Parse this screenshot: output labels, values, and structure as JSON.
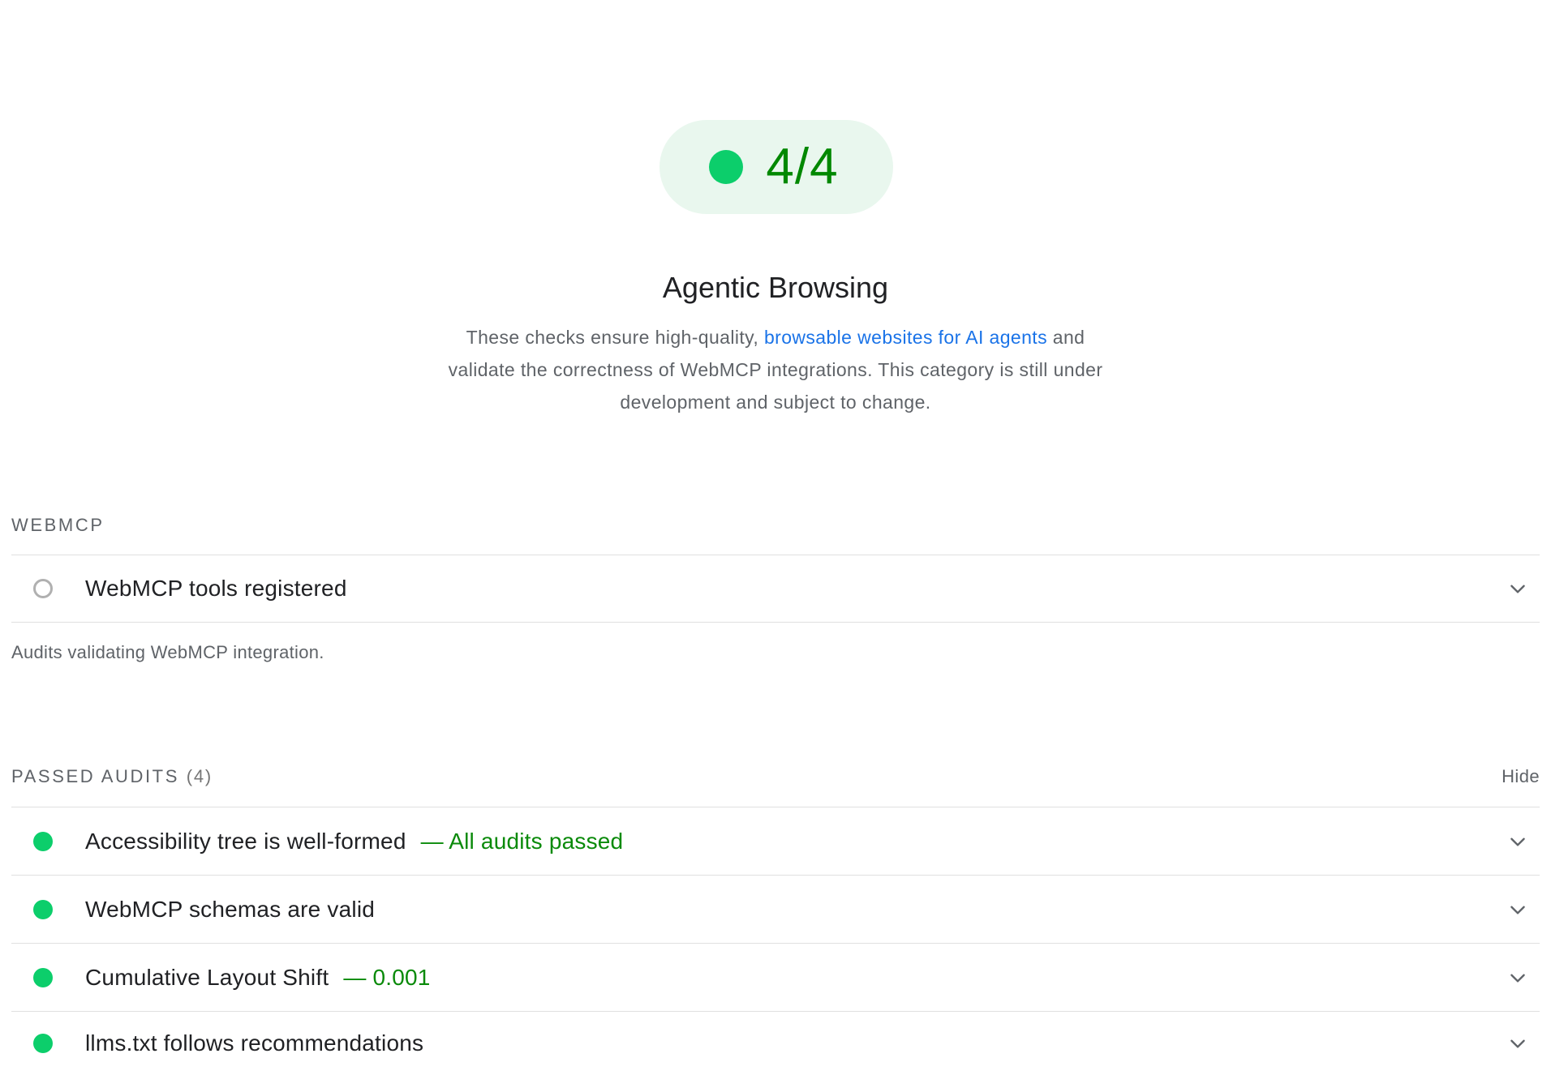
{
  "score": {
    "value": "4/4",
    "color": "#0cce6b"
  },
  "category": {
    "title": "Agentic Browsing",
    "description_prefix": "These checks ensure high-quality, ",
    "description_link": "browsable websites for AI agents",
    "description_suffix": " and validate the correctness of WebMCP integrations. This category is still under development and subject to change."
  },
  "webmcp_group": {
    "title": "WEBMCP",
    "description": "Audits validating WebMCP integration.",
    "audits": [
      {
        "title": "WebMCP tools registered",
        "status": "neutral",
        "display_value": "",
        "icon": "chevron-down-icon"
      }
    ]
  },
  "passed_group": {
    "title": "PASSED AUDITS",
    "count": "(4)",
    "toggle_label": "Hide",
    "audits": [
      {
        "title": "Accessibility tree is well-formed",
        "status": "pass",
        "display_value": "— All audits passed"
      },
      {
        "title": "WebMCP schemas are valid",
        "status": "pass",
        "display_value": ""
      },
      {
        "title": "Cumulative Layout Shift",
        "status": "pass",
        "display_value": "— 0.001"
      },
      {
        "title": "llms.txt follows recommendations",
        "status": "pass",
        "display_value": ""
      }
    ]
  },
  "colors": {
    "pass": "#0cce6b",
    "pass_text": "#008800",
    "link": "#1a73e8",
    "pill_bg": "#e9f7ee"
  }
}
